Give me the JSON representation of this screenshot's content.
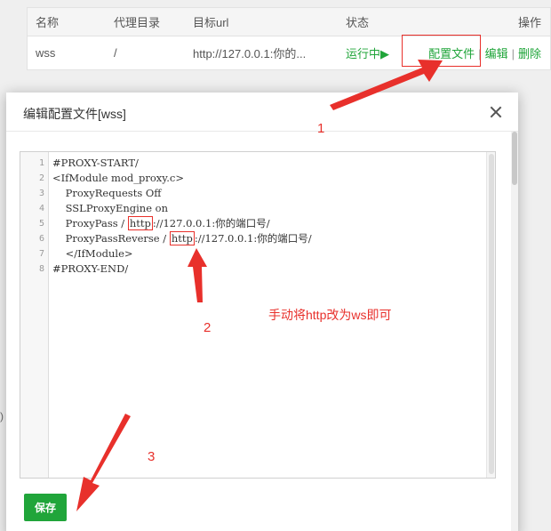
{
  "table": {
    "headers": {
      "name": "名称",
      "dir": "代理目录",
      "url": "目标url",
      "status": "状态",
      "ops": "操作"
    },
    "row": {
      "name": "wss",
      "dir": "/",
      "url": "http://127.0.0.1:你的...",
      "status": "运行中▶",
      "config": "配置文件",
      "edit": "编辑",
      "delete": "删除",
      "sep": "|"
    }
  },
  "stray": ")",
  "dialog": {
    "title": "编辑配置文件[wss]",
    "lines": [
      {
        "n": "1",
        "pre": "#PROXY-START/",
        "mark": "",
        "post": ""
      },
      {
        "n": "2",
        "pre": "<IfModule mod_proxy.c>",
        "mark": "",
        "post": ""
      },
      {
        "n": "3",
        "pre": "    ProxyRequests Off",
        "mark": "",
        "post": ""
      },
      {
        "n": "4",
        "pre": "    SSLProxyEngine on",
        "mark": "",
        "post": ""
      },
      {
        "n": "5",
        "pre": "    ProxyPass / ",
        "mark": "http",
        "post": "://127.0.0.1:你的端口号/"
      },
      {
        "n": "6",
        "pre": "    ProxyPassReverse / ",
        "mark": "http",
        "post": "://127.0.0.1:你的端口号/"
      },
      {
        "n": "7",
        "pre": "    </IfModule>",
        "mark": "",
        "post": ""
      },
      {
        "n": "8",
        "pre": "#PROXY-END/",
        "mark": "",
        "post": ""
      }
    ],
    "annotation": "手动将http改为ws即可",
    "save_label": "保存"
  },
  "steps": [
    "1",
    "2",
    "3"
  ],
  "colors": {
    "accent": "#20a53a",
    "annotation": "#e8302b"
  }
}
